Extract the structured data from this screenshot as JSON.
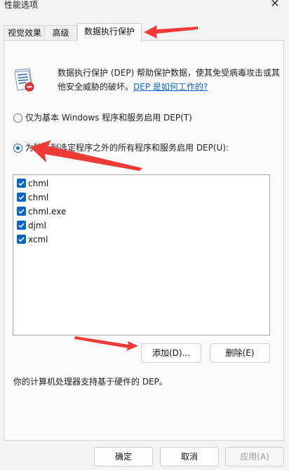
{
  "window": {
    "title": "性能选项",
    "close_glyph": "✕"
  },
  "tabs": [
    {
      "label": "视觉效果"
    },
    {
      "label": "高级"
    },
    {
      "label": "数据执行保护",
      "active": true
    }
  ],
  "dep": {
    "description": "数据执行保护 (DEP) 帮助保护数据，使其免受病毒攻击或其他安全威胁的破坏。",
    "link": "DEP 是如何工作的?",
    "icon": "dep-shield-document-icon",
    "option_essential": "仅为基本 Windows 程序和服务启用 DEP(T)",
    "option_all_except": "为除下列选定程序之外的所有程序和服务启用 DEP(U):",
    "selected_option": "all_except",
    "programs": [
      {
        "name": "chml",
        "checked": true
      },
      {
        "name": "chml",
        "checked": true
      },
      {
        "name": "chml.exe",
        "checked": true
      },
      {
        "name": "djml",
        "checked": true
      },
      {
        "name": "xcml",
        "checked": true
      }
    ],
    "add_button": "添加(D)...",
    "remove_button": "删除(E)",
    "hardware_support": "你的计算机处理器支持基于硬件的 DEP。"
  },
  "footer": {
    "ok": "确定",
    "cancel": "取消",
    "apply": "应用(A)"
  },
  "colors": {
    "accent": "#0a64c8",
    "annotation_arrow": "#ef3b36"
  }
}
